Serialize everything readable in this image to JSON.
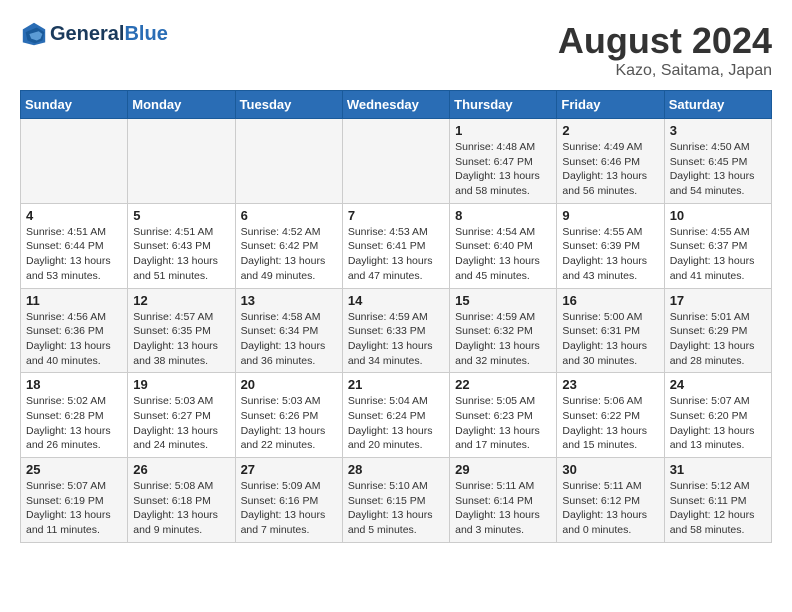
{
  "header": {
    "logo_line1": "General",
    "logo_line2": "Blue",
    "month": "August 2024",
    "location": "Kazo, Saitama, Japan"
  },
  "days_of_week": [
    "Sunday",
    "Monday",
    "Tuesday",
    "Wednesday",
    "Thursday",
    "Friday",
    "Saturday"
  ],
  "weeks": [
    [
      {
        "num": "",
        "info": ""
      },
      {
        "num": "",
        "info": ""
      },
      {
        "num": "",
        "info": ""
      },
      {
        "num": "",
        "info": ""
      },
      {
        "num": "1",
        "info": "Sunrise: 4:48 AM\nSunset: 6:47 PM\nDaylight: 13 hours\nand 58 minutes."
      },
      {
        "num": "2",
        "info": "Sunrise: 4:49 AM\nSunset: 6:46 PM\nDaylight: 13 hours\nand 56 minutes."
      },
      {
        "num": "3",
        "info": "Sunrise: 4:50 AM\nSunset: 6:45 PM\nDaylight: 13 hours\nand 54 minutes."
      }
    ],
    [
      {
        "num": "4",
        "info": "Sunrise: 4:51 AM\nSunset: 6:44 PM\nDaylight: 13 hours\nand 53 minutes."
      },
      {
        "num": "5",
        "info": "Sunrise: 4:51 AM\nSunset: 6:43 PM\nDaylight: 13 hours\nand 51 minutes."
      },
      {
        "num": "6",
        "info": "Sunrise: 4:52 AM\nSunset: 6:42 PM\nDaylight: 13 hours\nand 49 minutes."
      },
      {
        "num": "7",
        "info": "Sunrise: 4:53 AM\nSunset: 6:41 PM\nDaylight: 13 hours\nand 47 minutes."
      },
      {
        "num": "8",
        "info": "Sunrise: 4:54 AM\nSunset: 6:40 PM\nDaylight: 13 hours\nand 45 minutes."
      },
      {
        "num": "9",
        "info": "Sunrise: 4:55 AM\nSunset: 6:39 PM\nDaylight: 13 hours\nand 43 minutes."
      },
      {
        "num": "10",
        "info": "Sunrise: 4:55 AM\nSunset: 6:37 PM\nDaylight: 13 hours\nand 41 minutes."
      }
    ],
    [
      {
        "num": "11",
        "info": "Sunrise: 4:56 AM\nSunset: 6:36 PM\nDaylight: 13 hours\nand 40 minutes."
      },
      {
        "num": "12",
        "info": "Sunrise: 4:57 AM\nSunset: 6:35 PM\nDaylight: 13 hours\nand 38 minutes."
      },
      {
        "num": "13",
        "info": "Sunrise: 4:58 AM\nSunset: 6:34 PM\nDaylight: 13 hours\nand 36 minutes."
      },
      {
        "num": "14",
        "info": "Sunrise: 4:59 AM\nSunset: 6:33 PM\nDaylight: 13 hours\nand 34 minutes."
      },
      {
        "num": "15",
        "info": "Sunrise: 4:59 AM\nSunset: 6:32 PM\nDaylight: 13 hours\nand 32 minutes."
      },
      {
        "num": "16",
        "info": "Sunrise: 5:00 AM\nSunset: 6:31 PM\nDaylight: 13 hours\nand 30 minutes."
      },
      {
        "num": "17",
        "info": "Sunrise: 5:01 AM\nSunset: 6:29 PM\nDaylight: 13 hours\nand 28 minutes."
      }
    ],
    [
      {
        "num": "18",
        "info": "Sunrise: 5:02 AM\nSunset: 6:28 PM\nDaylight: 13 hours\nand 26 minutes."
      },
      {
        "num": "19",
        "info": "Sunrise: 5:03 AM\nSunset: 6:27 PM\nDaylight: 13 hours\nand 24 minutes."
      },
      {
        "num": "20",
        "info": "Sunrise: 5:03 AM\nSunset: 6:26 PM\nDaylight: 13 hours\nand 22 minutes."
      },
      {
        "num": "21",
        "info": "Sunrise: 5:04 AM\nSunset: 6:24 PM\nDaylight: 13 hours\nand 20 minutes."
      },
      {
        "num": "22",
        "info": "Sunrise: 5:05 AM\nSunset: 6:23 PM\nDaylight: 13 hours\nand 17 minutes."
      },
      {
        "num": "23",
        "info": "Sunrise: 5:06 AM\nSunset: 6:22 PM\nDaylight: 13 hours\nand 15 minutes."
      },
      {
        "num": "24",
        "info": "Sunrise: 5:07 AM\nSunset: 6:20 PM\nDaylight: 13 hours\nand 13 minutes."
      }
    ],
    [
      {
        "num": "25",
        "info": "Sunrise: 5:07 AM\nSunset: 6:19 PM\nDaylight: 13 hours\nand 11 minutes."
      },
      {
        "num": "26",
        "info": "Sunrise: 5:08 AM\nSunset: 6:18 PM\nDaylight: 13 hours\nand 9 minutes."
      },
      {
        "num": "27",
        "info": "Sunrise: 5:09 AM\nSunset: 6:16 PM\nDaylight: 13 hours\nand 7 minutes."
      },
      {
        "num": "28",
        "info": "Sunrise: 5:10 AM\nSunset: 6:15 PM\nDaylight: 13 hours\nand 5 minutes."
      },
      {
        "num": "29",
        "info": "Sunrise: 5:11 AM\nSunset: 6:14 PM\nDaylight: 13 hours\nand 3 minutes."
      },
      {
        "num": "30",
        "info": "Sunrise: 5:11 AM\nSunset: 6:12 PM\nDaylight: 13 hours\nand 0 minutes."
      },
      {
        "num": "31",
        "info": "Sunrise: 5:12 AM\nSunset: 6:11 PM\nDaylight: 12 hours\nand 58 minutes."
      }
    ]
  ]
}
